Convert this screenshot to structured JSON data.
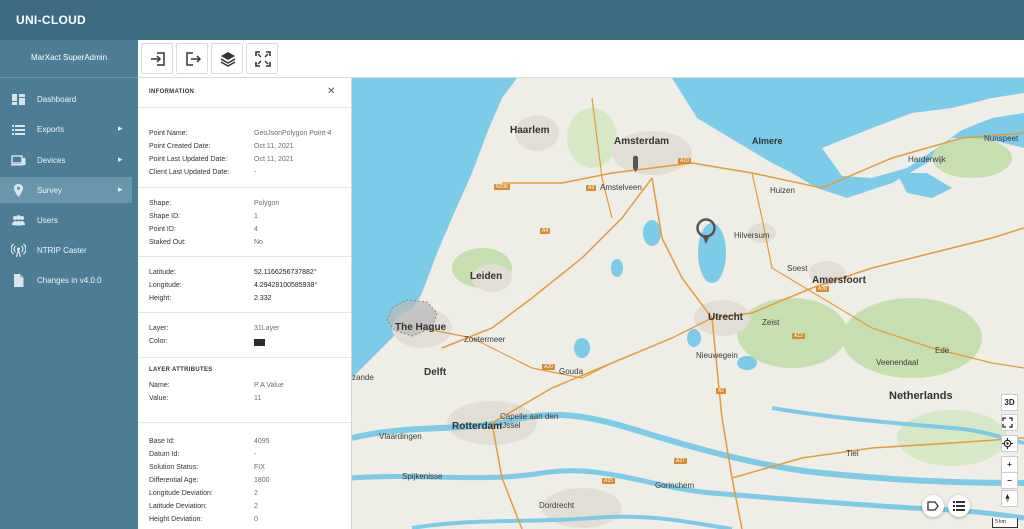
{
  "app": {
    "title": "UNI-CLOUD"
  },
  "sidebar": {
    "user": "MarXact SuperAdmin",
    "items": [
      {
        "label": "Dashboard",
        "icon": "dashboard-icon",
        "has_submenu": false,
        "active": false
      },
      {
        "label": "Exports",
        "icon": "list-icon",
        "has_submenu": true,
        "active": false
      },
      {
        "label": "Devices",
        "icon": "devices-icon",
        "has_submenu": true,
        "active": false
      },
      {
        "label": "Survey",
        "icon": "location-pin-icon",
        "has_submenu": true,
        "active": true
      },
      {
        "label": "Users",
        "icon": "users-icon",
        "has_submenu": false,
        "active": false
      },
      {
        "label": "NTRIP Caster",
        "icon": "antenna-icon",
        "has_submenu": false,
        "active": false
      },
      {
        "label": "Changes in v4.0.0",
        "icon": "document-icon",
        "has_submenu": false,
        "active": false
      }
    ]
  },
  "toolbar": {
    "buttons": [
      {
        "icon": "import-icon"
      },
      {
        "icon": "export-icon"
      },
      {
        "icon": "layers-icon"
      },
      {
        "icon": "fullscreen-icon"
      }
    ]
  },
  "info": {
    "header": "INFORMATION",
    "point_name_label": "Point Name:",
    "point_name": "GeoJsonPolygon Point-4",
    "point_created_label": "Point Created Date:",
    "point_created": "Oct 11, 2021",
    "point_updated_label": "Point Last Updated Date:",
    "point_updated": "Oct 11, 2021",
    "client_updated_label": "Client Last Updated Date:",
    "client_updated": "-",
    "shape_label": "Shape:",
    "shape": "Polygon",
    "shape_id_label": "Shape ID:",
    "shape_id": "1",
    "point_id_label": "Point ID:",
    "point_id": "4",
    "staked_label": "Staked Out:",
    "staked": "No",
    "latitude_label": "Latitude:",
    "latitude": "52.1166256737882°",
    "longitude_label": "Longitude:",
    "longitude": "4.29428100585938°",
    "height_label": "Height:",
    "height": "2.332",
    "layer_label": "Layer:",
    "layer": "31Layer",
    "color_label": "Color:",
    "color": "#2b2b2b",
    "attributes_header": "LAYER ATTRIBUTES",
    "attr_name_label": "Name:",
    "attr_name": "P A Value",
    "attr_value_label": "Value:",
    "attr_value": "11",
    "base_id_label": "Base Id:",
    "base_id": "4095",
    "datum_id_label": "Datum Id:",
    "datum_id": "-",
    "solution_status_label": "Solution Status:",
    "solution_status": "FIX",
    "differential_age_label": "Differential Age:",
    "differential_age": "1800",
    "longitude_dev_label": "Longitude Deviation:",
    "longitude_dev": "2",
    "latitude_dev_label": "Latitude Deviation:",
    "latitude_dev": "2",
    "height_dev_label": "Height Deviation:",
    "height_dev": "0"
  },
  "map": {
    "labels": {
      "haarlem": "Haarlem",
      "amsterdam": "Amsterdam",
      "almere": "Almere",
      "nunspeet": "Nunspeet",
      "harderwijk": "Harderwijk",
      "amstelveen": "Amstelveen",
      "huizen": "Huizen",
      "hilversum": "Hilversum",
      "leiden": "Leiden",
      "soest": "Soest",
      "amersfoort": "Amersfoort",
      "the_hague": "The Hague",
      "zoetermeer": "Zoetermeer",
      "utrecht": "Utrecht",
      "zeist": "Zeist",
      "ede": "Ede",
      "delft": "Delft",
      "gouda": "Gouda",
      "nieuwegein": "Nieuwegein",
      "veenendaal": "Veenendaal",
      "netherlands": "Netherlands",
      "capelle": "Capelle aan den IJssel",
      "rotterdam": "Rotterdam",
      "vlaardingen": "Vlaardingen",
      "spijkenisse": "Spijkenisse",
      "gorinchem": "Gorinchem",
      "dordrecht": "Dordrecht",
      "tiel": "Tiel",
      "zande": "zande"
    },
    "roads": {
      "n206": "N206",
      "a10": "A10",
      "a9": "A9",
      "a4": "A4",
      "a12": "A12",
      "a2": "A2",
      "a20": "A20",
      "a15": "A15",
      "a27": "A27",
      "a28": "A28"
    },
    "controls": {
      "three_d": "3D",
      "zoom_in": "+",
      "zoom_out": "−",
      "scale": "5 km"
    }
  }
}
